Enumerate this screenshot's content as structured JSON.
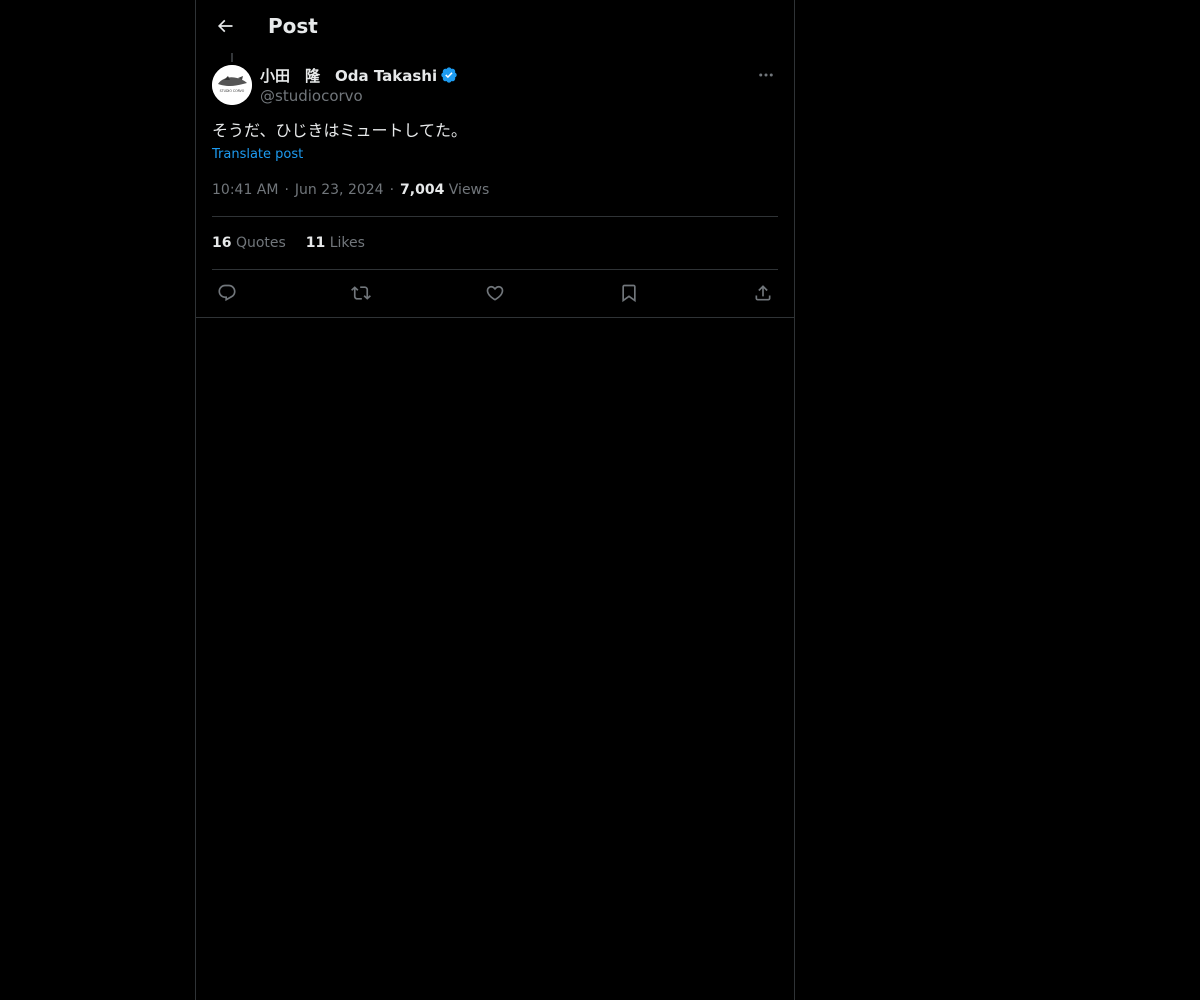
{
  "header": {
    "title": "Post"
  },
  "post": {
    "display_name": "小田　隆　Oda Takashi",
    "handle": "@studiocorvo",
    "text": "そうだ、ひじきはミュートしてた。",
    "translate_label": "Translate post",
    "time": "10:41 AM",
    "date": "Jun 23, 2024",
    "views_count": "7,004",
    "views_label": "Views",
    "quotes_count": "16",
    "quotes_label": "Quotes",
    "likes_count": "11",
    "likes_label": "Likes",
    "avatar_text": "STUDIO CORVO"
  },
  "icons": {
    "back": "arrow-left-icon",
    "verified": "verified-badge-icon",
    "more": "more-horizontal-icon",
    "reply": "reply-icon",
    "repost": "repost-icon",
    "like": "heart-icon",
    "bookmark": "bookmark-icon",
    "share": "share-icon"
  },
  "colors": {
    "background": "#000000",
    "text_primary": "#e7e9ea",
    "text_secondary": "#71767b",
    "accent": "#1d9bf0",
    "border": "#2f3336"
  }
}
